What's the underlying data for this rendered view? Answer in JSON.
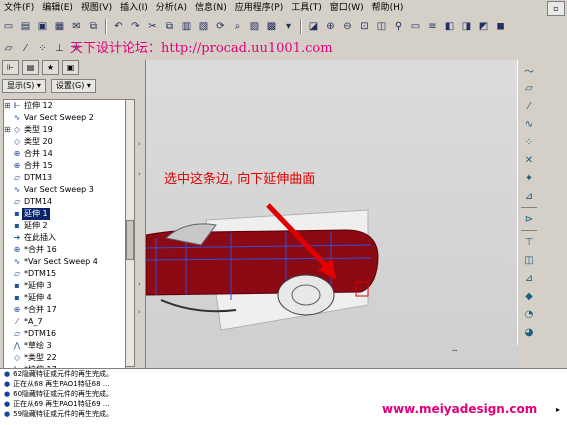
{
  "menu": [
    "文件(F)",
    "编辑(E)",
    "视图(V)",
    "插入(I)",
    "分析(A)",
    "信息(N)",
    "应用程序(P)",
    "工具(T)",
    "窗口(W)",
    "帮助(H)"
  ],
  "watermark_top": "天下设计论坛：http://procad.uu1001.com",
  "tree": {
    "show_label": "显示(S) ▾",
    "settings_label": "设置(G) ▾",
    "items": [
      {
        "exp": "⊞",
        "icon": "extrude-icon",
        "label": "拉伸 12"
      },
      {
        "exp": "",
        "icon": "sweep-icon",
        "label": "Var Sect Sweep 2"
      },
      {
        "exp": "⊞",
        "icon": "surface-icon",
        "label": "类型 19"
      },
      {
        "exp": "",
        "icon": "surface-icon",
        "label": "类型 20"
      },
      {
        "exp": "",
        "icon": "merge-icon",
        "label": "合并 14"
      },
      {
        "exp": "",
        "icon": "merge-icon",
        "label": "合并 15"
      },
      {
        "exp": "",
        "icon": "datum-plane-icon",
        "label": "DTM13"
      },
      {
        "exp": "",
        "icon": "sweep-icon",
        "label": "Var Sect Sweep 3"
      },
      {
        "exp": "",
        "icon": "datum-plane-icon",
        "label": "DTM14"
      },
      {
        "exp": "",
        "icon": "extend-icon",
        "label": "延伸 1",
        "selected": true
      },
      {
        "exp": "",
        "icon": "extend-icon",
        "label": "延伸 2"
      },
      {
        "exp": "",
        "icon": "insert-here-icon",
        "label": "在此插入"
      },
      {
        "exp": "",
        "icon": "merge-icon",
        "label": "*合并 16"
      },
      {
        "exp": "",
        "icon": "sweep-icon",
        "label": "*Var Sect Sweep 4"
      },
      {
        "exp": "",
        "icon": "datum-plane-icon",
        "label": "*DTM15"
      },
      {
        "exp": "",
        "icon": "extend-icon",
        "label": "*延伸 3"
      },
      {
        "exp": "",
        "icon": "extend-icon",
        "label": "*延伸 4"
      },
      {
        "exp": "",
        "icon": "merge-icon",
        "label": "*合并 17"
      },
      {
        "exp": "",
        "icon": "axis-icon",
        "label": "*A_7"
      },
      {
        "exp": "",
        "icon": "datum-plane-icon",
        "label": "*DTM16"
      },
      {
        "exp": "",
        "icon": "sketch-icon",
        "label": "*草绘 3"
      },
      {
        "exp": "",
        "icon": "surface-icon",
        "label": "*类型 22"
      },
      {
        "exp": "",
        "icon": "extrude-icon",
        "label": "*拉伸 17"
      },
      {
        "exp": "",
        "icon": "surface-icon",
        "label": "*类型 23"
      }
    ]
  },
  "annotation": "选中这条边, 向下延伸曲面",
  "messages": [
    "62隐藏特征或元件的再生完成。",
    "正在从68 再生PAO1特征68 ...",
    "60隐藏特征或元件的再生完成。",
    "正在从69 再生PAO1特征69 ...",
    "59隐藏特征或元件的再生完成。"
  ],
  "watermark_bottom": "www.meiyadesign.com",
  "colors": {
    "body_red": "#8b0a14",
    "annotation_red": "#e00000",
    "watermark_pink": "#e2007a",
    "selection_blue": "#0a246a"
  }
}
